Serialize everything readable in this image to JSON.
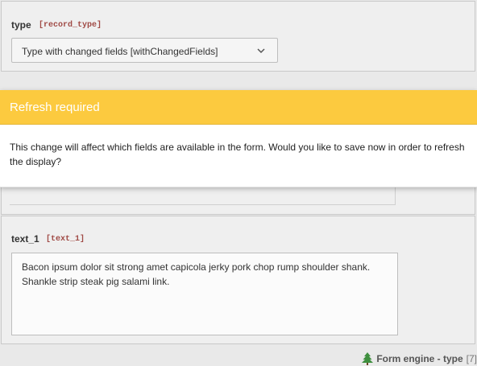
{
  "form": {
    "type_field": {
      "label": "type",
      "code": "[record_type]",
      "selected": "Type with changed fields [withChangedFields]"
    },
    "text_field": {
      "label": "text_1",
      "code": "[text_1]",
      "value": "Bacon ipsum dolor sit strong amet capicola jerky pork chop rump shoulder shank. Shankle strip steak pig salami link."
    }
  },
  "modal": {
    "title": "Refresh required",
    "message": "This change will affect which fields are available in the form. Would you like to save now in order to refresh the display?",
    "header_color": "#fcca3f"
  },
  "footer": {
    "record_title": "Form engine - type",
    "record_uid": "[7]",
    "icon": "tree-icon"
  }
}
